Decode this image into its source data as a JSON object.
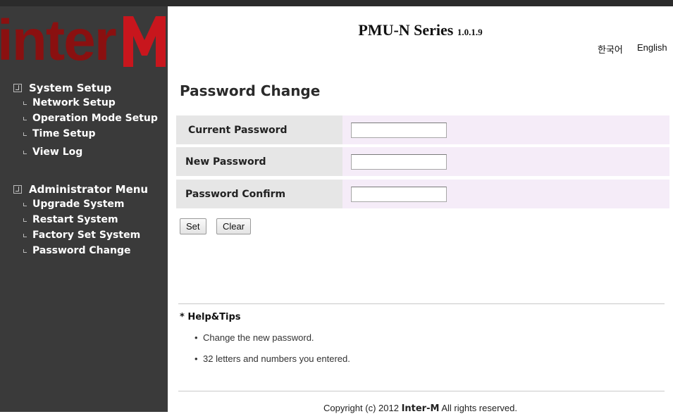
{
  "header": {
    "brand_logo_text": "InterM",
    "title": "PMU-N Series",
    "version": "1.0.1.9",
    "lang_korean": "한국어",
    "lang_english": "English"
  },
  "sidebar": {
    "system_setup": {
      "heading": "System Setup",
      "items": [
        "Network Setup",
        "Operation Mode Setup",
        "Time Setup",
        "View Log"
      ]
    },
    "admin_menu": {
      "heading": "Administrator Menu",
      "items": [
        "Upgrade System",
        "Restart System",
        "Factory Set System",
        "Password Change"
      ]
    }
  },
  "main": {
    "page_title": "Password Change",
    "fields": [
      {
        "label": "Current Password",
        "value": ""
      },
      {
        "label": "New Password",
        "value": ""
      },
      {
        "label": "Password Confirm",
        "value": ""
      }
    ],
    "set_button": "Set",
    "clear_button": "Clear",
    "help_title": "* Help&Tips",
    "tips": [
      "Change the new password.",
      "32 letters and numbers you entered."
    ],
    "copyright_prefix": "Copyright (c) 2012",
    "copyright_brand": "Inter-M",
    "copyright_suffix": "All rights reserved."
  },
  "colors": {
    "sidebar_bg": "#3a3a3a",
    "logo_red": "#c8161d",
    "label_bg": "#e6e6e6",
    "value_bg": "#f5ecf8"
  }
}
